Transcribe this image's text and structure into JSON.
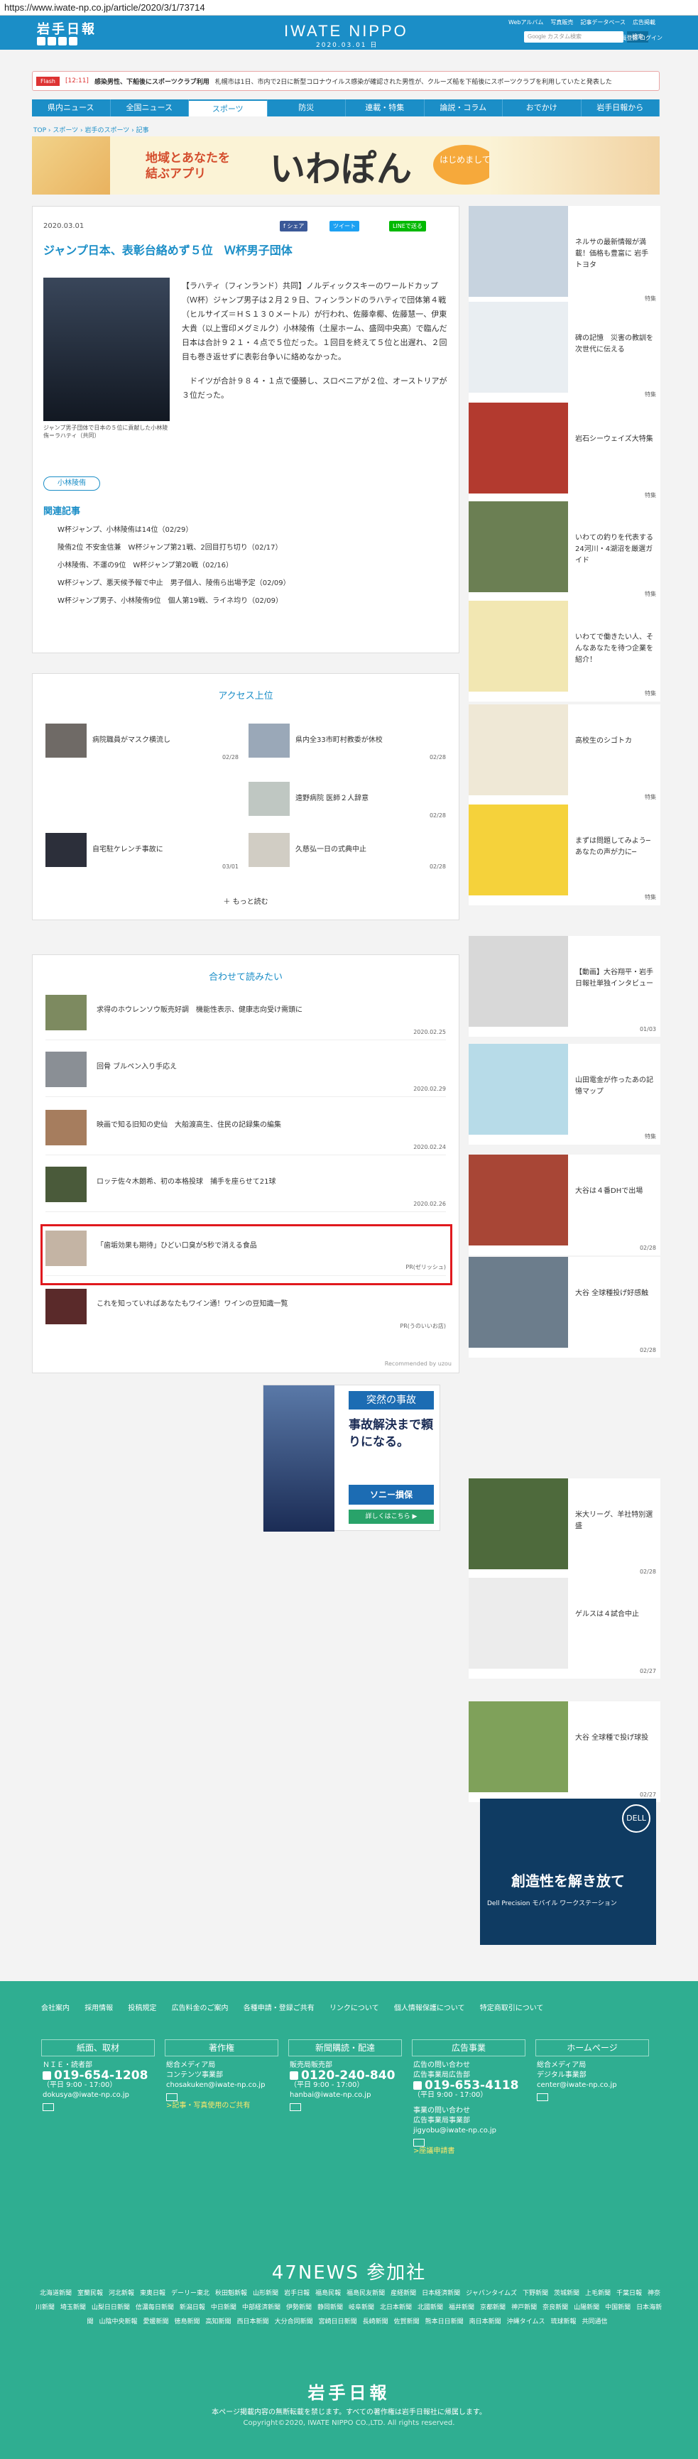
{
  "browser": {
    "url": "https://www.iwate-np.co.jp/article/2020/3/1/73714"
  },
  "header": {
    "logo_jp": "岩手日報",
    "brand": "IWATE NIPPO",
    "date": "2020.03.01 日",
    "links": [
      "Webアルバム",
      "写真販売",
      "記事データベース",
      "広告掲載"
    ],
    "search_placeholder": "Google カスタム検索",
    "search_button": "検索",
    "account": [
      "会員登録",
      "ログイン"
    ]
  },
  "flash": {
    "label": "Flash",
    "time": "[12:11]",
    "headline": "感染男性、下船後にスポーツクラブ利用",
    "text": "札幌市は1日、市内で2日に新型コロナウイルス感染が確認された男性が、クルーズ船を下船後にスポーツクラブを利用していたと発表した"
  },
  "nav": [
    "県内ニュース",
    "全国ニュース",
    "スポーツ",
    "防災",
    "連載・特集",
    "論説・コラム",
    "おでかけ",
    "岩手日報から"
  ],
  "breadcrumb": "TOP › スポーツ › 岩手のスポーツ › 記事",
  "banner": {
    "line1": "地域とあなたを",
    "line2": "結ぶアプリ",
    "app": "いわぽん",
    "badge": "はじめまして"
  },
  "article": {
    "date": "2020.03.01",
    "share": [
      "f シェア",
      "ツイート",
      "LINEで送る"
    ],
    "title": "ジャンプ日本、表彰台絡めず５位　Ｗ杯男子団体",
    "caption": "ジャンプ男子団体で日本の５位に貢献した小林陵侑＝ラハティ（共同）",
    "body1": "【ラハティ（フィンランド）共同】ノルディックスキーのワールドカップ（Ｗ杯）ジャンプ男子は２月２９日、フィンランドのラハティで団体第４戦（ヒルサイズ＝ＨＳ１３０メートル）が行われ、佐藤幸椰、佐藤慧一、伊東大貴（以上雪印メグミルク）小林陵侑（土屋ホーム、盛岡中央高）で臨んだ日本は合計９２１・４点で５位だった。１回目を終えて５位と出遅れ、２回目も巻き返せずに表彰台争いに絡めなかった。",
    "body2": "ドイツが合計９８４・１点で優勝し、スロベニアが２位、オーストリアが３位だった。",
    "tag": "小林陵侑",
    "related_heading": "関連記事",
    "related": [
      "W杯ジャンプ、小林陵侑は14位（02/29）",
      "陵侑2位 不安金信兼　W杯ジャンプ第21戦、2回目打ち切り（02/17）",
      "小林陵侑、不運の9位　W杯ジャンプ第20戦（02/16）",
      "W杯ジャンプ、悪天候予報で中止　男子個人、陵侑ら出場予定（02/09）",
      "W杯ジャンプ男子、小林陵侑9位　個人第19戦、ライネ均り（02/09）"
    ]
  },
  "access": {
    "title": "アクセス上位",
    "items": [
      {
        "title": "病院職員がマスク横流し",
        "date": "02/28"
      },
      {
        "title": "県内全33市町村教委が休校",
        "date": "02/28"
      },
      {
        "title": "",
        "date": ""
      },
      {
        "title": "遠野病院 医師２人辞意",
        "date": "02/28"
      },
      {
        "title": "自宅駐ケレンチ事故に",
        "date": "03/01"
      },
      {
        "title": "久慈弘一日の式典中止",
        "date": "02/28"
      }
    ],
    "more": "もっと読む"
  },
  "recommend": {
    "title": "合わせて読みたい",
    "items": [
      {
        "title": "求得のホウレンソウ販売好調　機能性表示、健康志向受け需頭に",
        "date": "2020.02.25"
      },
      {
        "title": "回骨 ブルペン入り手応え",
        "date": "2020.02.29"
      },
      {
        "title": "映画で知る旧知の史仙　大船渡高生、住民の記録集の編集",
        "date": "2020.02.24"
      },
      {
        "title": "ロッテ佐々木朗希、初の本格投球　捕手を座らせて21球",
        "date": "2020.02.26"
      },
      {
        "title": "「歯垢効果も期待」ひどい口臭が5秒で消える食品",
        "date": "PR(ゼリッシュ)"
      },
      {
        "title": "これを知っていればあなたもワイン通！ワインの豆知識一覧",
        "date": "PR(うのいいお店)"
      }
    ],
    "powered": "Recommended by uzou"
  },
  "ad_center": {
    "head": "突然の事故",
    "main": "事故解決まで頼りになる。",
    "brand": "ソニー損保",
    "link": "詳しくはこちら ▶"
  },
  "sidebar": [
    {
      "title": "ネルサの最新情報が満載！価格も豊富に 岩手トヨタ",
      "date": "特集",
      "color": "#c7d3df"
    },
    {
      "title": "碑の記憶　災害の教訓を次世代に伝える",
      "date": "特集",
      "color": "#e9eef2"
    },
    {
      "title": "岩石シーウェイズ大特集",
      "date": "特集",
      "color": "#b33a2f"
    },
    {
      "title": "いわての釣りを代表する24河川・4湖沼を厳選ガイド",
      "date": "特集",
      "color": "#6b7f53"
    },
    {
      "title": "いわてで働きたい人、そんなあなたを待つ企業を紹介！",
      "date": "特集",
      "color": "#f2e7b2"
    },
    {
      "title": "高校生のシゴトカ",
      "date": "特集",
      "color": "#efe8d6"
    },
    {
      "title": "まずは問題してみよう─あなたの声が力に─",
      "date": "特集",
      "color": "#f5d23b"
    },
    {
      "title": "【動画】大谷翔平・岩手日報社単独インタビュー",
      "date": "01/03",
      "color": "#d8d8d8"
    },
    {
      "title": "山田電金が作ったあの記憶マップ",
      "date": "特集",
      "color": "#b7dbe8"
    },
    {
      "title": "大谷は４番DHで出場",
      "date": "02/28",
      "color": "#a84636"
    },
    {
      "title": "大谷 全球種投げ好感触",
      "date": "02/28",
      "color": "#6c7d8c"
    },
    {
      "title": "米大リーグ、羊社特別選盛",
      "date": "02/28",
      "color": "#4e6a3c"
    },
    {
      "title": "ゲルスは４試合中止",
      "date": "02/27",
      "color": "#ececec"
    },
    {
      "title": "大谷 全球種で投げ球投",
      "date": "02/27",
      "color": "#7fa15a"
    }
  ],
  "side_ad": {
    "title": "創造性を解き放て",
    "sub": "Dell Precision モバイル ワークステーション",
    "brand": "DELL"
  },
  "footer": {
    "links": [
      "会社案内",
      "採用情報",
      "投稿規定",
      "広告料金のご案内",
      "各種申請・登録ご共有",
      "リンクについて",
      "個人情報保護について",
      "特定商取引について"
    ],
    "columns": [
      {
        "head": "紙面、取材",
        "l1": "ＮＩＥ・読者部",
        "phone": "019-654-1208",
        "l2": "（平日 9:00 - 17:00）",
        "mail": "dokusya@iwate-np.co.jp"
      },
      {
        "head": "著作権",
        "l1": "総合メディア局",
        "l2": "コンテンツ事業部",
        "mail": "chosakuken@iwate-np.co.jp",
        "link": ">記事・写真使用のご共有"
      },
      {
        "head": "新聞購読・配達",
        "l1": "販売局販売部",
        "phone": "0120-240-840",
        "l2": "（平日 9:00 - 17:00）",
        "mail": "hanbai@iwate-np.co.jp"
      },
      {
        "head": "広告事業",
        "l1": "広告の問い合わせ",
        "l2": "広告事業局広告部",
        "phone": "019-653-4118",
        "l3": "（平日 9:00 - 17:00）",
        "l4": "事業の問い合わせ",
        "l5": "広告事業局事業部",
        "mail": "jigyobu@iwate-np.co.jp",
        "link": ">座議申請書"
      },
      {
        "head": "ホームページ",
        "l1": "総合メディア局",
        "l2": "デジタル事業部",
        "mail": "center@iwate-np.co.jp"
      }
    ],
    "news47": "47NEWS 参加社",
    "news_list": [
      "北海道新聞",
      "室蘭民報",
      "河北新報",
      "東奥日報",
      "デーリー東北",
      "秋田魁新報",
      "山形新聞",
      "岩手日報",
      "福島民報",
      "福島民友新聞",
      "産経新聞",
      "日本経済新聞",
      "ジャパンタイムズ",
      "下野新聞",
      "茨城新聞",
      "上毛新聞",
      "千葉日報",
      "神奈川新聞",
      "埼玉新聞",
      "山梨日日新聞",
      "信濃毎日新聞",
      "新潟日報",
      "中日新聞",
      "中部経済新聞",
      "伊勢新聞",
      "静岡新聞",
      "岐阜新聞",
      "北日本新聞",
      "北國新聞",
      "福井新聞",
      "京都新聞",
      "神戸新聞",
      "奈良新聞",
      "山陽新聞",
      "中国新聞",
      "日本海新聞",
      "山陰中央新報",
      "愛媛新聞",
      "徳島新聞",
      "高知新聞",
      "西日本新聞",
      "大分合同新聞",
      "宮崎日日新聞",
      "長崎新聞",
      "佐賀新聞",
      "熊本日日新聞",
      "南日本新聞",
      "沖縄タイムス",
      "琉球新報",
      "共同通信"
    ],
    "logo": "岩手日報",
    "copy1": "本ページ掲載内容の無断転載を禁じます。すべての著作権は岩手日報社に帰属します。",
    "copy2": "Copyright©2020, IWATE NIPPO CO.,LTD. All rights reserved."
  }
}
